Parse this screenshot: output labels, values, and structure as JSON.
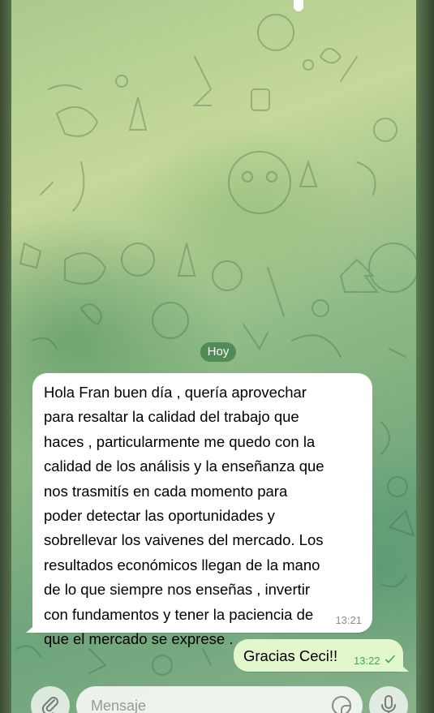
{
  "chat": {
    "date_separator": "Hoy",
    "messages": [
      {
        "direction": "incoming",
        "text": "Hola Fran buen día , quería aprovechar\npara resaltar la calidad del trabajo que\nhaces , particularmente me quedo con la\ncalidad de los análisis y la enseñanza que\nnos trasmitís en cada momento para\npoder detectar las oportunidades y\nsobrellevar los vaivenes del mercado. Los\nresultados económicos llegan de la mano\nde lo que siempre nos enseñas , invertir\ncon fundamentos y tener la paciencia de\nque el mercado se exprese .",
        "time": "13:21"
      },
      {
        "direction": "outgoing",
        "text": "Gracias Ceci!!",
        "time": "13:22",
        "status_icon": "single-check-icon"
      }
    ]
  },
  "composer": {
    "placeholder": "Mensaje",
    "attach_icon": "paperclip-icon",
    "sticker_icon": "sticker-icon",
    "mic_icon": "microphone-icon"
  },
  "colors": {
    "outgoing_bubble": "#e2f7cb",
    "incoming_bubble": "#ffffff",
    "date_pill": "#468250",
    "check": "#4aa35c"
  }
}
